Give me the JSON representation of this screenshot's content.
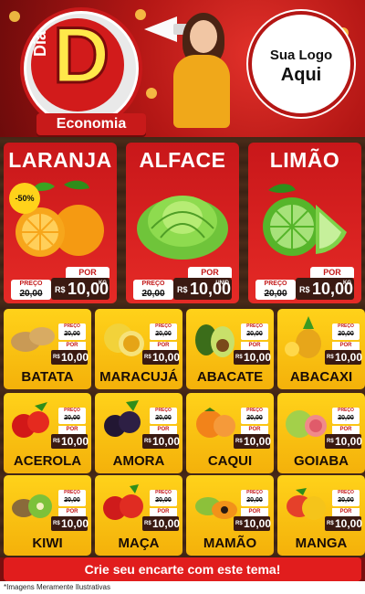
{
  "header": {
    "badge_top": "Dia",
    "badge_letter": "D",
    "badge_ribbon": "Economia",
    "logo_line1": "Sua Logo",
    "logo_line2": "Aqui"
  },
  "featured": [
    {
      "name": "LARANJA",
      "discount": "-50%",
      "por_label": "POR",
      "preco_label": "PREÇO",
      "old_price": "20,00",
      "currency": "R$",
      "price": "10,00",
      "unit": "KG",
      "icon": "orange-icon"
    },
    {
      "name": "ALFACE",
      "por_label": "POR",
      "preco_label": "PREÇO",
      "old_price": "20,00",
      "currency": "R$",
      "price": "10,00",
      "unit": "UNID",
      "icon": "lettuce-icon"
    },
    {
      "name": "LIMÃO",
      "por_label": "POR",
      "preco_label": "PREÇO",
      "old_price": "20,00",
      "currency": "R$",
      "price": "10,00",
      "unit": "KG",
      "icon": "lime-icon"
    }
  ],
  "products": [
    {
      "name": "BATATA",
      "preco_label": "PREÇO",
      "old_price": "20,00",
      "por_label": "POR",
      "currency": "R$",
      "price": "10,00",
      "icon": "potato-icon"
    },
    {
      "name": "MARACUJÁ",
      "preco_label": "PREÇO",
      "old_price": "20,00",
      "por_label": "POR",
      "currency": "R$",
      "price": "10,00",
      "icon": "passionfruit-icon"
    },
    {
      "name": "ABACATE",
      "preco_label": "PREÇO",
      "old_price": "20,00",
      "por_label": "POR",
      "currency": "R$",
      "price": "10,00",
      "icon": "avocado-icon"
    },
    {
      "name": "ABACAXI",
      "preco_label": "PREÇO",
      "old_price": "20,00",
      "por_label": "POR",
      "currency": "R$",
      "price": "10,00",
      "icon": "pineapple-icon"
    },
    {
      "name": "ACEROLA",
      "preco_label": "PREÇO",
      "old_price": "20,00",
      "por_label": "POR",
      "currency": "R$",
      "price": "10,00",
      "icon": "acerola-icon"
    },
    {
      "name": "AMORA",
      "preco_label": "PREÇO",
      "old_price": "20,00",
      "por_label": "POR",
      "currency": "R$",
      "price": "10,00",
      "icon": "blackberry-icon"
    },
    {
      "name": "CAQUI",
      "preco_label": "PREÇO",
      "old_price": "20,00",
      "por_label": "POR",
      "currency": "R$",
      "price": "10,00",
      "icon": "persimmon-icon"
    },
    {
      "name": "GOIABA",
      "preco_label": "PREÇO",
      "old_price": "20,00",
      "por_label": "POR",
      "currency": "R$",
      "price": "10,00",
      "icon": "guava-icon"
    },
    {
      "name": "KIWI",
      "preco_label": "PREÇO",
      "old_price": "20,00",
      "por_label": "POR",
      "currency": "R$",
      "price": "10,00",
      "icon": "kiwi-icon"
    },
    {
      "name": "MAÇA",
      "preco_label": "PREÇO",
      "old_price": "20,00",
      "por_label": "POR",
      "currency": "R$",
      "price": "10,00",
      "icon": "apple-icon"
    },
    {
      "name": "MAMÃO",
      "preco_label": "PREÇO",
      "old_price": "20,00",
      "por_label": "POR",
      "currency": "R$",
      "price": "10,00",
      "icon": "papaya-icon"
    },
    {
      "name": "MANGA",
      "preco_label": "PREÇO",
      "old_price": "20,00",
      "por_label": "POR",
      "currency": "R$",
      "price": "10,00",
      "icon": "mango-icon"
    }
  ],
  "footer": {
    "cta": "Crie seu encarte com este tema!",
    "disclaimer": "*Imagens Meramente Ilustrativas"
  },
  "colors": {
    "header_red": "#b41715",
    "card_yellow": "#ffd21a",
    "price_brown": "#3a1a12",
    "cta_red": "#e11d1d"
  }
}
